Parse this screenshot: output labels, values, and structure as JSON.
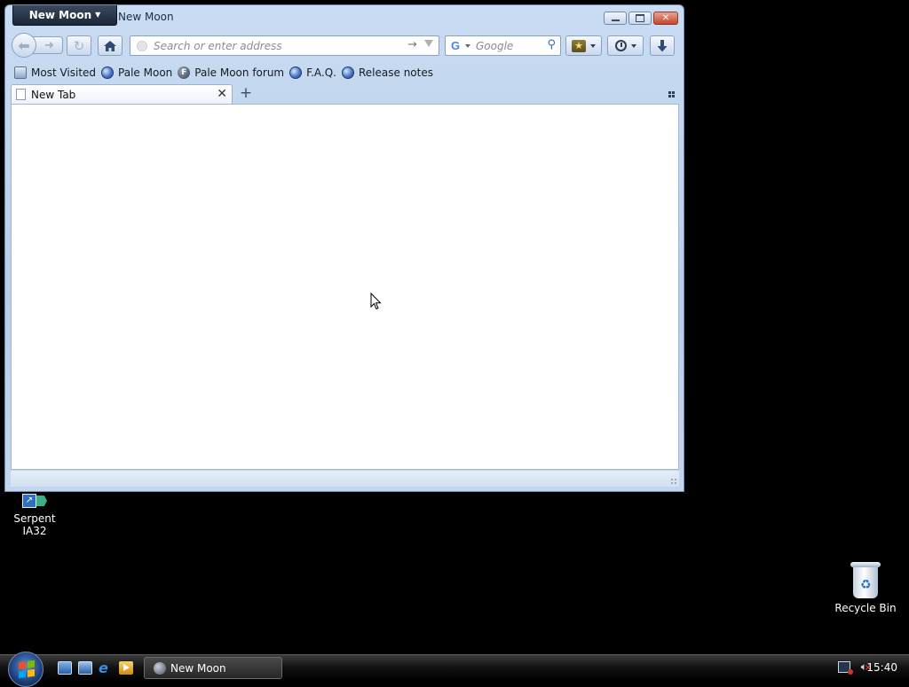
{
  "window": {
    "app_menu_label": "New Moon",
    "title": "New Moon",
    "controls": {
      "minimize": "minimize-icon",
      "maximize": "maximize-icon",
      "close": "close-icon"
    }
  },
  "navbar": {
    "url_placeholder": "Search or enter address",
    "search_placeholder": "Google",
    "icons": [
      "back-icon",
      "forward-icon",
      "reload-icon",
      "home-icon",
      "go-arrow-icon",
      "dropdown-icon",
      "google-icon",
      "search-magnifier-icon",
      "bookmarks-star-icon",
      "history-clock-icon",
      "downloads-arrow-icon"
    ]
  },
  "bookmarks": [
    {
      "label": "Most Visited",
      "icon": "most-visited-icon"
    },
    {
      "label": "Pale Moon",
      "icon": "globe-icon"
    },
    {
      "label": "Pale Moon forum",
      "icon": "forum-icon"
    },
    {
      "label": "F.A.Q.",
      "icon": "globe-icon"
    },
    {
      "label": "Release notes",
      "icon": "globe-icon"
    }
  ],
  "tabs": [
    {
      "label": "New Tab",
      "active": true
    }
  ],
  "desktop": {
    "icons": [
      {
        "label": "Serpent IA32",
        "icon": "shortcut-icon"
      },
      {
        "label": "Recycle Bin",
        "icon": "recycle-bin-icon"
      }
    ]
  },
  "taskbar": {
    "task_label": "New Moon",
    "clock": "15:40"
  },
  "colors": {
    "window_frame": "#c9dcf3",
    "app_menu_button": "#1c2638",
    "desktop": "#000000",
    "taskbar": "#101010"
  }
}
